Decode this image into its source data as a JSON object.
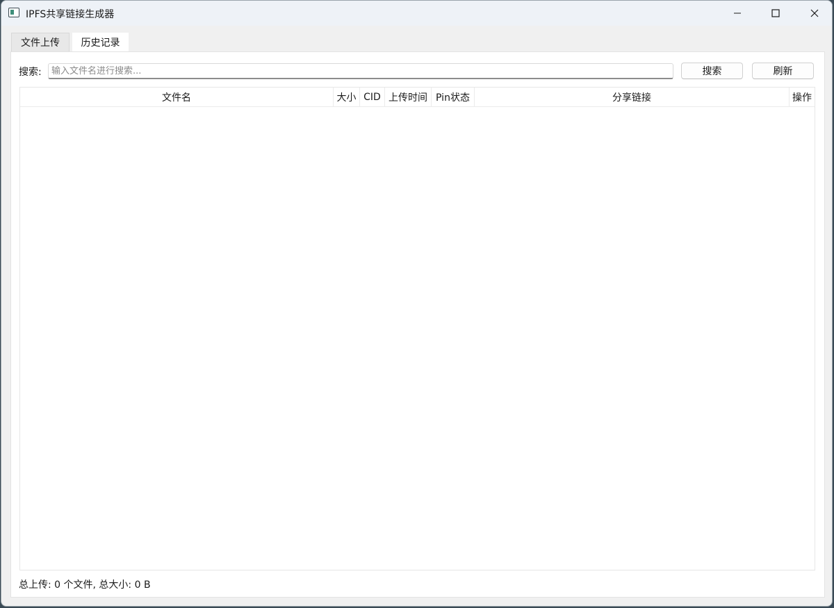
{
  "window": {
    "title": "IPFS共享链接生成器",
    "icon": "app-window-icon"
  },
  "tabs": [
    {
      "label": "文件上传",
      "active": false
    },
    {
      "label": "历史记录",
      "active": true
    }
  ],
  "search": {
    "label": "搜索:",
    "placeholder": "输入文件名进行搜索...",
    "value": "",
    "search_button": "搜索",
    "refresh_button": "刷新"
  },
  "table": {
    "columns": [
      "文件名",
      "大小",
      "CID",
      "上传时间",
      "Pin状态",
      "分享链接",
      "操作"
    ],
    "rows": []
  },
  "status": {
    "text": "总上传: 0 个文件, 总大小: 0 B"
  }
}
